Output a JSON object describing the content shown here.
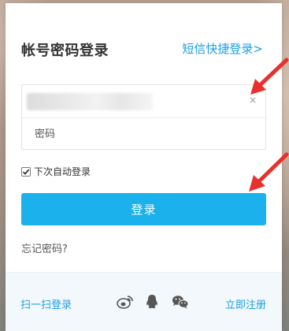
{
  "dialog": {
    "title": "帐号密码登录",
    "sms_login_link": "短信快捷登录>",
    "account_clear": "×",
    "password_placeholder": "密码",
    "remember_label": "下次自动登录",
    "remember_checked": true,
    "login_button": "登录",
    "forgot_password": "忘记密码?"
  },
  "footer": {
    "qr_login": "扫一扫登录",
    "register": "立即注册",
    "social_icons": [
      "weibo-icon",
      "qq-icon",
      "wechat-icon"
    ]
  },
  "colors": {
    "accent": "#1ab1ec",
    "link": "#1a9ee6",
    "annotation_arrow": "#e8302c"
  }
}
